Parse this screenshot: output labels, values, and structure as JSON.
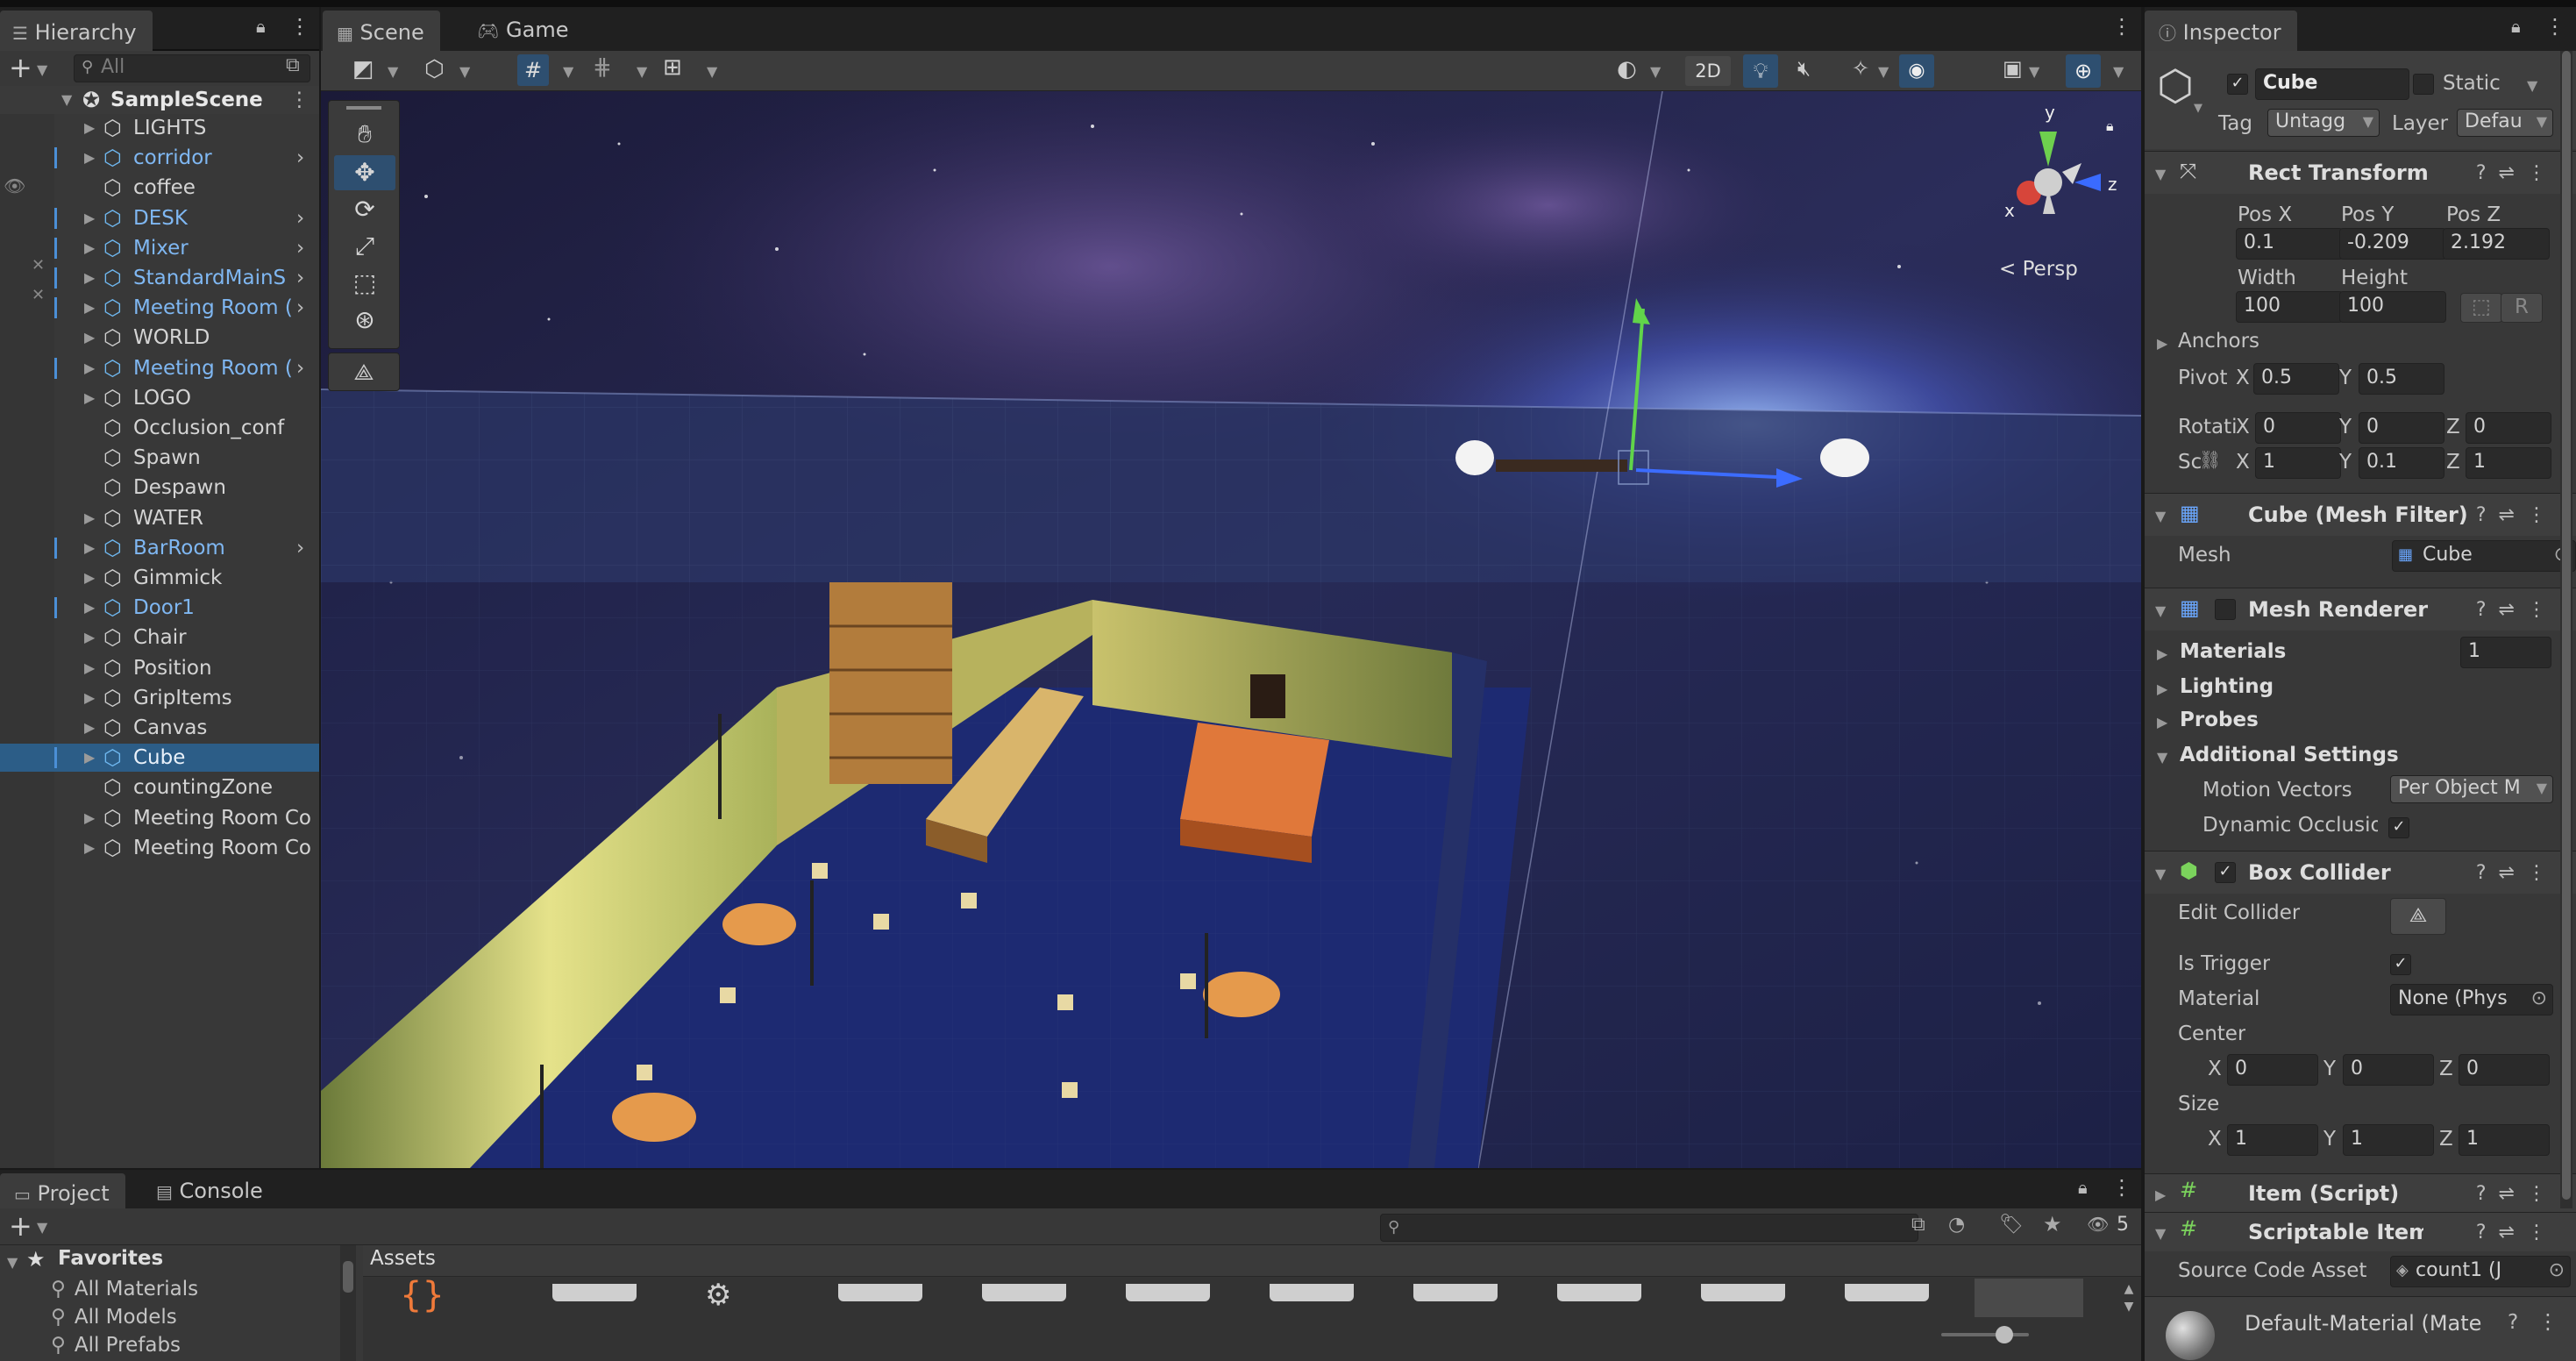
{
  "hierarchy": {
    "tab": "Hierarchy",
    "search_placeholder": "All",
    "scene": "SampleScene",
    "items": [
      {
        "label": "LIGHTS",
        "prefab": false
      },
      {
        "label": "corridor",
        "prefab": true
      },
      {
        "label": "coffee",
        "prefab": false
      },
      {
        "label": "DESK",
        "prefab": true
      },
      {
        "label": "Mixer",
        "prefab": true
      },
      {
        "label": "StandardMainS",
        "prefab": true
      },
      {
        "label": "Meeting Room (",
        "prefab": true
      },
      {
        "label": "WORLD",
        "prefab": false
      },
      {
        "label": "Meeting Room (",
        "prefab": true
      },
      {
        "label": "LOGO",
        "prefab": false
      },
      {
        "label": "Occlusion_conf",
        "prefab": false
      },
      {
        "label": "Spawn",
        "prefab": false
      },
      {
        "label": "Despawn",
        "prefab": false
      },
      {
        "label": "WATER",
        "prefab": false
      },
      {
        "label": "BarRoom",
        "prefab": true
      },
      {
        "label": "Gimmick",
        "prefab": false
      },
      {
        "label": "Door1",
        "prefab": true
      },
      {
        "label": "Chair",
        "prefab": false
      },
      {
        "label": "Position",
        "prefab": false
      },
      {
        "label": "GripItems",
        "prefab": false
      },
      {
        "label": "Canvas",
        "prefab": false
      },
      {
        "label": "Cube",
        "prefab": true
      },
      {
        "label": "countingZone",
        "prefab": false
      },
      {
        "label": "Meeting Room Cou",
        "prefab": false
      },
      {
        "label": "Meeting Room Cou",
        "prefab": false
      }
    ]
  },
  "scene_view": {
    "tab_scene": "Scene",
    "tab_game": "Game",
    "btn_2d": "2D",
    "gizmo_y": "y",
    "gizmo_x": "x",
    "gizmo_z": "z",
    "persp": "< Persp"
  },
  "inspector": {
    "tab": "Inspector",
    "object_name": "Cube",
    "static_label": "Static",
    "tag_label": "Tag",
    "tag_value": "Untagg",
    "layer_label": "Layer",
    "layer_value": "Defau",
    "rect_transform": {
      "title": "Rect Transform",
      "pos_x_label": "Pos X",
      "pos_y_label": "Pos Y",
      "pos_z_label": "Pos Z",
      "pos_x": "0.1",
      "pos_y": "-0.209",
      "pos_z": "2.192",
      "width_label": "Width",
      "height_label": "Height",
      "width": "100",
      "height": "100",
      "r_btn": "R",
      "anchors": "Anchors",
      "pivot_label": "Pivot",
      "pivot_x_label": "X",
      "pivot_x": "0.5",
      "pivot_y_label": "Y",
      "pivot_y": "0.5",
      "rotation_label": "Rotati",
      "rot_x_label": "X",
      "rot_x": "0",
      "rot_y_label": "Y",
      "rot_y": "0",
      "rot_z_label": "Z",
      "rot_z": "0",
      "scale_label": "Sc",
      "scale_x_label": "X",
      "scale_x": "1",
      "scale_y_label": "Y",
      "scale_y": "0.1",
      "scale_z_label": "Z",
      "scale_z": "1"
    },
    "mesh_filter": {
      "title": "Cube (Mesh Filter)",
      "mesh_label": "Mesh",
      "mesh_value": "Cube"
    },
    "mesh_renderer": {
      "title": "Mesh Renderer",
      "materials": "Materials",
      "materials_count": "1",
      "lighting": "Lighting",
      "probes": "Probes",
      "additional": "Additional Settings",
      "motion_vectors": "Motion Vectors",
      "motion_value": "Per Object M",
      "dynamic_occlusion": "Dynamic Occlusio"
    },
    "box_collider": {
      "title": "Box Collider",
      "edit_collider": "Edit Collider",
      "is_trigger": "Is Trigger",
      "material_label": "Material",
      "material_value": "None (Phys",
      "center": "Center",
      "cx": "0",
      "cy": "0",
      "cz": "0",
      "size": "Size",
      "sx": "1",
      "sy": "1",
      "sz": "1",
      "x": "X",
      "y": "Y",
      "z": "Z"
    },
    "item_script": {
      "title": "Item (Script)"
    },
    "scriptable_item": {
      "title": "Scriptable Item (Sc",
      "source_label": "Source Code Asset",
      "source_value": "count1 (J"
    },
    "default_material": "Default-Material (Mate"
  },
  "project": {
    "tab_project": "Project",
    "tab_console": "Console",
    "favorites": "Favorites",
    "fav_items": [
      "All Materials",
      "All Models",
      "All Prefabs"
    ],
    "assets_header": "Assets",
    "hidden_count": "5"
  }
}
